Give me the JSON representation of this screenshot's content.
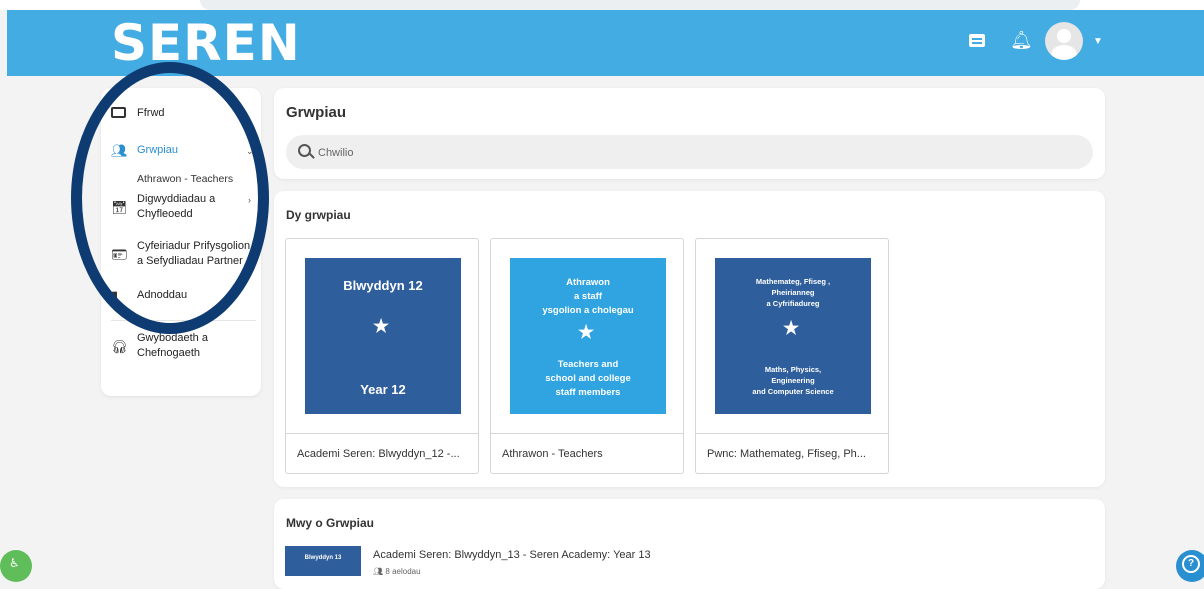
{
  "header": {
    "logo": "SEREN",
    "icons": [
      "chat-icon",
      "bell-icon",
      "avatar-icon",
      "caret-down-icon"
    ],
    "brand_color": "#42ace3"
  },
  "sidebar": {
    "items": [
      {
        "label": "Ffrwd",
        "icon": "feed-icon"
      },
      {
        "label": "Grwpiau",
        "icon": "people-icon",
        "active": true
      },
      {
        "label": "Digwyddiadau a Chyfleoedd",
        "icon": "calendar-icon"
      },
      {
        "label": "Cyfeiriadur Prifysgolion a Sefydliadau Partner",
        "icon": "id-card-icon"
      },
      {
        "label": "Adnoddau",
        "icon": "document-icon"
      },
      {
        "label": "Gwybodaeth a Chefnogaeth",
        "icon": "support-icon"
      }
    ],
    "sub_item": "Athrawon - Teachers",
    "accent_color": "#2a8fd0"
  },
  "main": {
    "title": "Grwpiau",
    "search": {
      "placeholder": "Chwilio"
    },
    "my_groups": {
      "heading": "Dy grwpiau",
      "groups": [
        {
          "name": "Academi Seren: Blwyddyn_12 -...",
          "image_top": "Blwyddyn 12",
          "image_bottom": "Year 12",
          "color": "#2e5e9c"
        },
        {
          "name": "Athrawon - Teachers",
          "image_top": "Athrawon\na staff\nysgolion a cholegau",
          "image_bottom": "Teachers and\nschool and college\nstaff members",
          "color": "#2fa4e0"
        },
        {
          "name": "Pwnc: Mathemateg, Ffiseg, Ph...",
          "image_top": "Mathemateg, Ffiseg ,\nPheirianneg\na Cyfrifiadureg",
          "image_bottom": "Maths, Physics,\nEngineering\nand Computer Science",
          "color": "#2e5e9c"
        }
      ]
    },
    "more_groups": {
      "heading": "Mwy o Grwpiau",
      "item": {
        "thumb": "Blwyddyn 13",
        "title": "Academi Seren: Blwyddyn_13 - Seren Academy: Year 13",
        "members": "8 aelodau"
      }
    }
  }
}
